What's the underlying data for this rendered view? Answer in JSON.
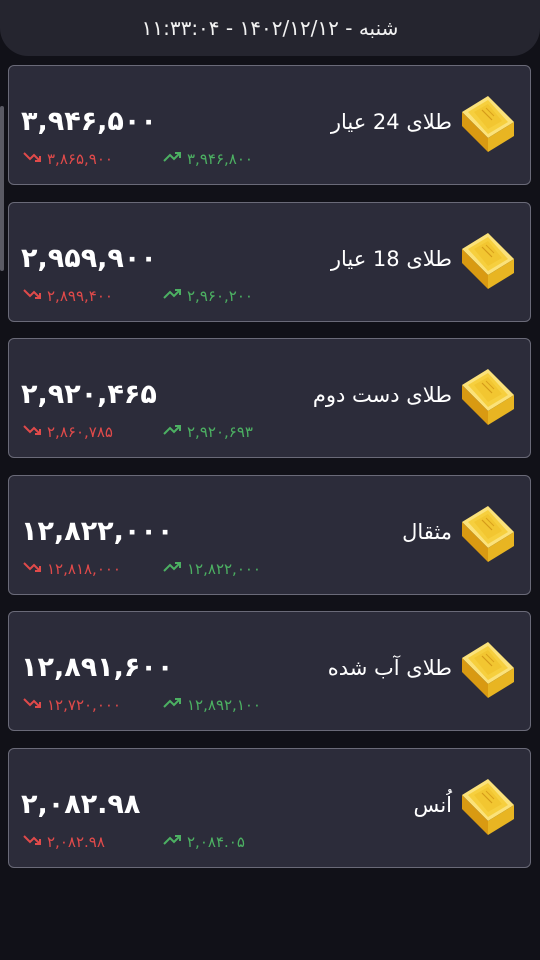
{
  "header": {
    "datetime": "شنبه - ۱۴۰۲/۱۲/۱۲ - ۱۱:۳۳:۰۴"
  },
  "colors": {
    "background": "#111118",
    "card": "#2c2c3a",
    "down": "#e04a4a",
    "up": "#4cb062",
    "gold": "#f2c230"
  },
  "items": [
    {
      "name": "طلای 24 عیار",
      "price": "۳,۹۴۶,۵۰۰",
      "low": "۳,۸۶۵,۹۰۰",
      "high": "۳,۹۴۶,۸۰۰",
      "icon": "gold-bar-icon"
    },
    {
      "name": "طلای 18 عیار",
      "price": "۲,۹۵۹,۹۰۰",
      "low": "۲,۸۹۹,۴۰۰",
      "high": "۲,۹۶۰,۲۰۰",
      "icon": "gold-bar-icon"
    },
    {
      "name": "طلای دست دوم",
      "price": "۲,۹۲۰,۴۶۵",
      "low": "۲,۸۶۰,۷۸۵",
      "high": "۲,۹۲۰,۶۹۳",
      "icon": "gold-bar-icon"
    },
    {
      "name": "مثقال",
      "price": "۱۲,۸۲۲,۰۰۰",
      "low": "۱۲,۸۱۸,۰۰۰",
      "high": "۱۲,۸۲۲,۰۰۰",
      "icon": "gold-bar-icon"
    },
    {
      "name": "طلای آب شده",
      "price": "۱۲,۸۹۱,۶۰۰",
      "low": "۱۲,۷۲۰,۰۰۰",
      "high": "۱۲,۸۹۲,۱۰۰",
      "icon": "gold-bar-icon"
    },
    {
      "name": "اُنس",
      "price": "۲,۰۸۲.۹۸",
      "low": "۲,۰۸۲.۹۸",
      "high": "۲,۰۸۴.۰۵",
      "icon": "gold-bar-icon"
    }
  ]
}
